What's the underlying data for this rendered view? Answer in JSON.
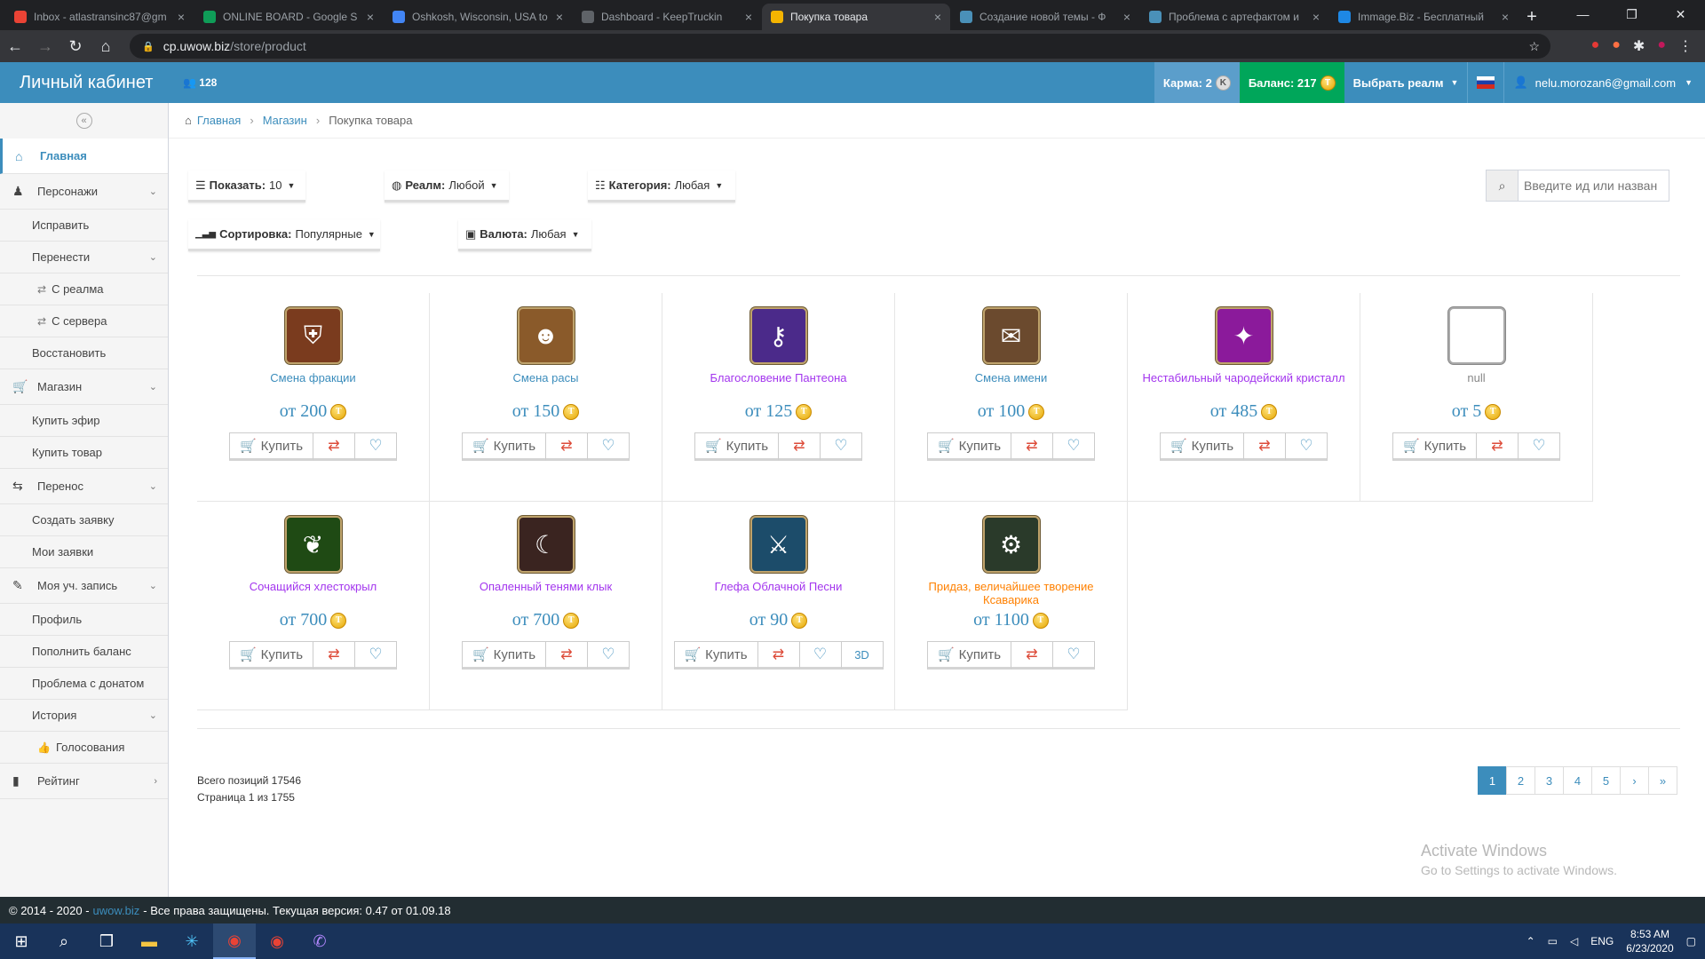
{
  "browser": {
    "tabs": [
      {
        "title": "Inbox - atlastransinc87@gm",
        "color": "#ea4335",
        "active": false
      },
      {
        "title": "ONLINE BOARD - Google S",
        "color": "#0f9d58",
        "active": false
      },
      {
        "title": "Oshkosh, Wisconsin, USA to",
        "color": "#4285f4",
        "active": false
      },
      {
        "title": "Dashboard - KeepTruckin",
        "color": "#5f6368",
        "active": false
      },
      {
        "title": "Покупка товара",
        "color": "#f4b400",
        "active": true
      },
      {
        "title": "Создание новой темы - Ф",
        "color": "#4a90b8",
        "active": false
      },
      {
        "title": "Проблема с артефактом и",
        "color": "#4a90b8",
        "active": false
      },
      {
        "title": "Immage.Biz - Бесплатный",
        "color": "#1e88e5",
        "active": false
      }
    ],
    "url_host": "cp.uwow.biz",
    "url_path": "/store/product"
  },
  "header": {
    "logo": "Личный кабинет",
    "friends_count": "128",
    "karma_label": "Карма: 2",
    "karma_icon": "K",
    "balance_label": "Баланс: 217",
    "realm_label": "Выбрать реалм",
    "user_email": "nelu.morozan6@gmail.com"
  },
  "sidebar": {
    "collapse_icon": "«",
    "items": [
      {
        "label": "Главная",
        "kind": "item",
        "icon": "⌂",
        "active": true
      },
      {
        "label": "Персонажи",
        "kind": "item",
        "icon": "♟",
        "chev": "⌄"
      },
      {
        "label": "Исправить",
        "kind": "sub"
      },
      {
        "label": "Перенести",
        "kind": "sub",
        "chev": "⌄"
      },
      {
        "label": "С реалма",
        "kind": "sub2",
        "icon": "⇄"
      },
      {
        "label": "С сервера",
        "kind": "sub2",
        "icon": "⇄"
      },
      {
        "label": "Восстановить",
        "kind": "sub"
      },
      {
        "label": "Магазин",
        "kind": "item",
        "icon": "🛒",
        "chev": "⌄"
      },
      {
        "label": "Купить эфир",
        "kind": "sub"
      },
      {
        "label": "Купить товар",
        "kind": "sub"
      },
      {
        "label": "Перенос",
        "kind": "item",
        "icon": "⇆",
        "chev": "⌄"
      },
      {
        "label": "Создать заявку",
        "kind": "sub"
      },
      {
        "label": "Мои заявки",
        "kind": "sub"
      },
      {
        "label": "Моя уч. запись",
        "kind": "item",
        "icon": "✎",
        "chev": "⌄"
      },
      {
        "label": "Профиль",
        "kind": "sub"
      },
      {
        "label": "Пополнить баланс",
        "kind": "sub"
      },
      {
        "label": "Проблема с донатом",
        "kind": "sub"
      },
      {
        "label": "История",
        "kind": "sub",
        "chev": "⌄"
      },
      {
        "label": "Голосования",
        "kind": "sub2",
        "icon": "👍"
      },
      {
        "label": "Рейтинг",
        "kind": "item",
        "icon": "▮",
        "chev": "›"
      }
    ]
  },
  "breadcrumb": {
    "home": "Главная",
    "store": "Магазин",
    "current": "Покупка товара"
  },
  "filters": {
    "show": {
      "label": "Показать:",
      "value": "10"
    },
    "realm": {
      "label": "Реалм:",
      "value": "Любой"
    },
    "category": {
      "label": "Категория:",
      "value": "Любая"
    },
    "sort": {
      "label": "Сортировка:",
      "value": "Популярные"
    },
    "currency": {
      "label": "Валюта:",
      "value": "Любая"
    },
    "search_placeholder": "Введите ид или назван"
  },
  "products": [
    {
      "name": "Смена фракции",
      "price": "от 200",
      "name_color": "#3c8dbc",
      "icon_bg": "#7a3b1e",
      "glyph": "⛨",
      "has_3d": false
    },
    {
      "name": "Смена расы",
      "price": "от 150",
      "name_color": "#3c8dbc",
      "icon_bg": "#8a5a2a",
      "glyph": "☻",
      "has_3d": false
    },
    {
      "name": "Благословение Пантеона",
      "price": "от 125",
      "name_color": "#a335ee",
      "icon_bg": "#4b2a8a",
      "glyph": "⚷",
      "has_3d": false
    },
    {
      "name": "Смена имени",
      "price": "от 100",
      "name_color": "#3c8dbc",
      "icon_bg": "#6b4a2e",
      "glyph": "✉",
      "has_3d": false
    },
    {
      "name": "Нестабильный чародейский кристалл",
      "price": "от 485",
      "name_color": "#a335ee",
      "icon_bg": "#8b1a9b",
      "glyph": "✦",
      "has_3d": false
    },
    {
      "name": "null",
      "price": "от 5",
      "name_color": "#888888",
      "icon_bg": "#ffffff",
      "glyph": "",
      "has_3d": false
    },
    {
      "name": "Сочащийся хлестокрыл",
      "price": "от 700",
      "name_color": "#a335ee",
      "icon_bg": "#1f4a14",
      "glyph": "❦",
      "has_3d": false
    },
    {
      "name": "Опаленный тенями клык",
      "price": "от 700",
      "name_color": "#a335ee",
      "icon_bg": "#3a2420",
      "glyph": "☾",
      "has_3d": false
    },
    {
      "name": "Глефа Облачной Песни",
      "price": "от 90",
      "name_color": "#a335ee",
      "icon_bg": "#1c4c6a",
      "glyph": "⚔",
      "has_3d": true
    },
    {
      "name": "Придаз, величайшее творение Ксаварика",
      "price": "от 1100",
      "name_color": "#ff8000",
      "icon_bg": "#2a3a2a",
      "glyph": "⚙",
      "has_3d": false
    }
  ],
  "buttons": {
    "buy": "Купить",
    "view3d": "3D"
  },
  "summary": {
    "total": "Всего позиций 17546",
    "page": "Страница 1 из 1755"
  },
  "pagination": [
    "1",
    "2",
    "3",
    "4",
    "5",
    "›",
    "»"
  ],
  "watermark": {
    "line1": "Activate Windows",
    "line2": "Go to Settings to activate Windows."
  },
  "footer": {
    "prefix": "© 2014 - 2020 -",
    "link": "uwow.biz",
    "suffix": "- Все права защищены. Текущая версия: 0.47 от 01.09.18"
  },
  "taskbar": {
    "lang": "ENG",
    "time": "8:53 AM",
    "date": "6/23/2020"
  }
}
